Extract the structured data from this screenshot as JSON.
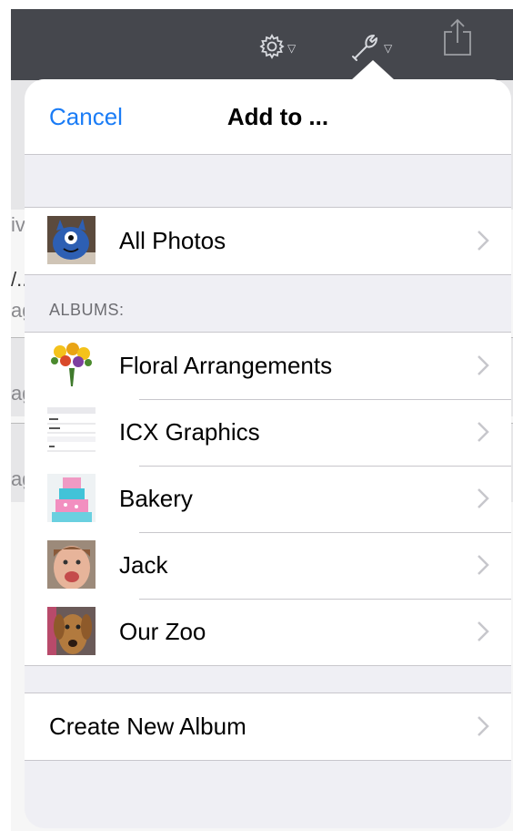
{
  "toolbar": {
    "icons": [
      "gear-icon",
      "wrench-icon",
      "share-icon"
    ],
    "background": "#45474d"
  },
  "background_page": {
    "fragments": [
      "iv",
      "/..",
      "ag",
      "ag",
      "ag"
    ]
  },
  "popover": {
    "cancel_label": "Cancel",
    "title": "Add to ...",
    "all_photos_label": "All Photos",
    "albums_header": "ALBUMS:",
    "albums": [
      {
        "label": "Floral Arrangements",
        "thumb": "flowers-thumbnail"
      },
      {
        "label": "ICX Graphics",
        "thumb": "document-thumbnail"
      },
      {
        "label": "Bakery",
        "thumb": "cake-thumbnail"
      },
      {
        "label": "Jack",
        "thumb": "boy-thumbnail"
      },
      {
        "label": "Our Zoo",
        "thumb": "dog-thumbnail"
      }
    ],
    "create_album_label": "Create New Album"
  },
  "colors": {
    "accent": "#1a7cf6",
    "grouped_background": "#efeff4",
    "separator": "#c8c7cc",
    "chevron": "#c7c7cc"
  }
}
